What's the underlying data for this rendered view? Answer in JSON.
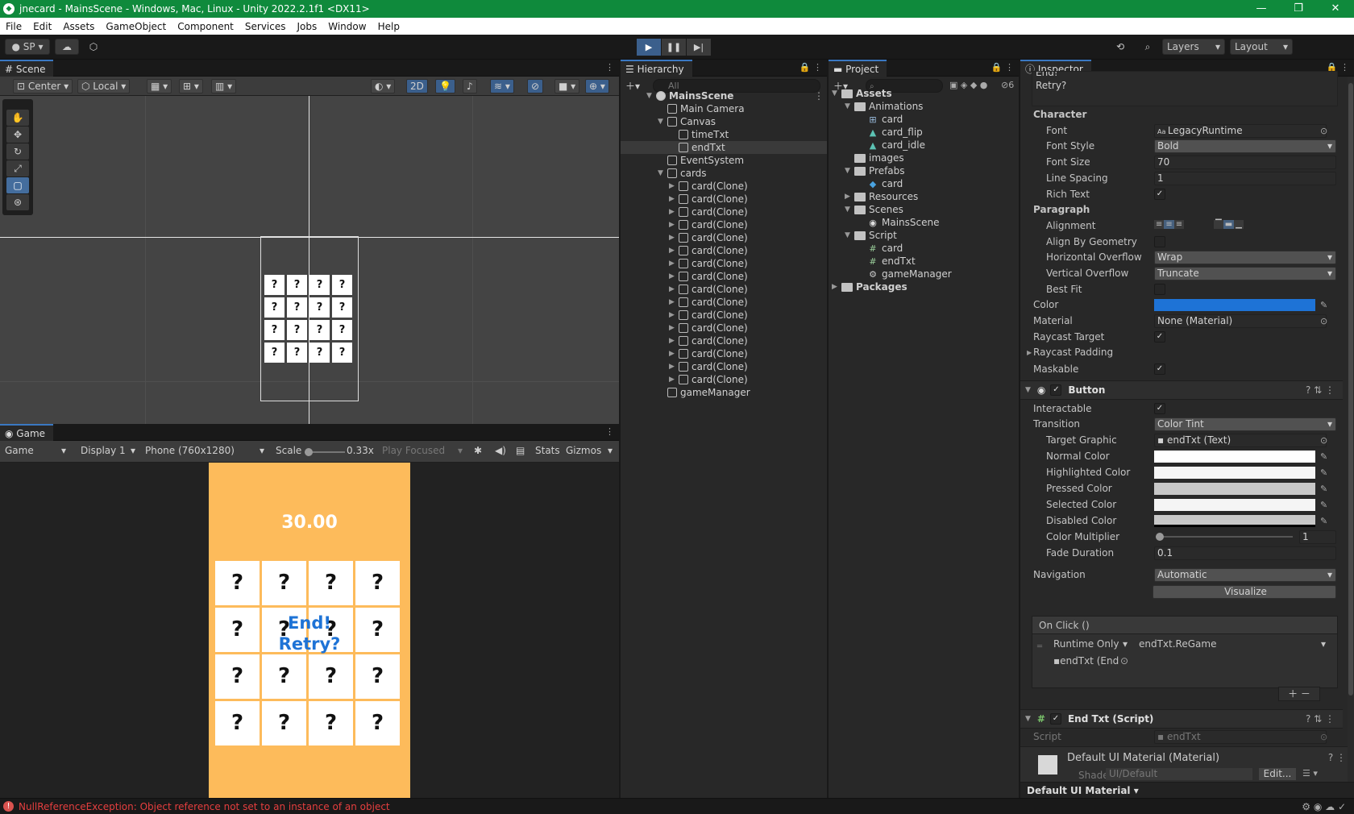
{
  "window": {
    "title": "jnecard - MainsScene - Windows, Mac, Linux - Unity 2022.2.1f1 <DX11>",
    "controls": [
      "—",
      "❐",
      "✕"
    ]
  },
  "menu": [
    "File",
    "Edit",
    "Assets",
    "GameObject",
    "Component",
    "Services",
    "Jobs",
    "Window",
    "Help"
  ],
  "toolbar": {
    "account": "SP",
    "layers": "Layers",
    "layout": "Layout"
  },
  "scene": {
    "tab": "Scene",
    "pivot": "Center",
    "space": "Local",
    "mode_2d": "2D",
    "cards": [
      "?",
      "?",
      "?",
      "?",
      "?",
      "?",
      "?",
      "?",
      "?",
      "?",
      "?",
      "?",
      "?",
      "?",
      "?",
      "?"
    ]
  },
  "game": {
    "tab": "Game",
    "view": "Game",
    "display": "Display 1",
    "resolution": "Phone (760x1280)",
    "scale_label": "Scale",
    "scale_value": "0.33x",
    "play_focused": "Play Focused",
    "stats": "Stats",
    "gizmos": "Gizmos",
    "timer": "30.00",
    "end_line1": "End!",
    "end_line2": "Retry?",
    "cards": [
      "?",
      "?",
      "?",
      "?",
      "?",
      "?",
      "?",
      "?",
      "?",
      "?",
      "?",
      "?",
      "?",
      "?",
      "?",
      "?"
    ]
  },
  "hierarchy": {
    "tab": "Hierarchy",
    "search_placeholder": "All",
    "items": [
      {
        "label": "MainsScene",
        "depth": 0
      },
      {
        "label": "Main Camera",
        "depth": 1
      },
      {
        "label": "Canvas",
        "depth": 1
      },
      {
        "label": "timeTxt",
        "depth": 2
      },
      {
        "label": "endTxt",
        "depth": 2
      },
      {
        "label": "EventSystem",
        "depth": 1
      },
      {
        "label": "cards",
        "depth": 1
      },
      {
        "label": "card(Clone)",
        "depth": 2
      },
      {
        "label": "card(Clone)",
        "depth": 2
      },
      {
        "label": "card(Clone)",
        "depth": 2
      },
      {
        "label": "card(Clone)",
        "depth": 2
      },
      {
        "label": "card(Clone)",
        "depth": 2
      },
      {
        "label": "card(Clone)",
        "depth": 2
      },
      {
        "label": "card(Clone)",
        "depth": 2
      },
      {
        "label": "card(Clone)",
        "depth": 2
      },
      {
        "label": "card(Clone)",
        "depth": 2
      },
      {
        "label": "card(Clone)",
        "depth": 2
      },
      {
        "label": "card(Clone)",
        "depth": 2
      },
      {
        "label": "card(Clone)",
        "depth": 2
      },
      {
        "label": "card(Clone)",
        "depth": 2
      },
      {
        "label": "card(Clone)",
        "depth": 2
      },
      {
        "label": "card(Clone)",
        "depth": 2
      },
      {
        "label": "card(Clone)",
        "depth": 2
      },
      {
        "label": "gameManager",
        "depth": 1
      }
    ]
  },
  "project": {
    "tab": "Project",
    "badge": "6",
    "items": [
      {
        "label": "Assets",
        "depth": 0,
        "kind": "folder"
      },
      {
        "label": "Animations",
        "depth": 1,
        "kind": "folder"
      },
      {
        "label": "card",
        "depth": 2,
        "kind": "anim"
      },
      {
        "label": "card_flip",
        "depth": 2,
        "kind": "clip"
      },
      {
        "label": "card_idle",
        "depth": 2,
        "kind": "clip"
      },
      {
        "label": "images",
        "depth": 1,
        "kind": "folder"
      },
      {
        "label": "Prefabs",
        "depth": 1,
        "kind": "folder"
      },
      {
        "label": "card",
        "depth": 2,
        "kind": "prefab"
      },
      {
        "label": "Resources",
        "depth": 1,
        "kind": "folder"
      },
      {
        "label": "Scenes",
        "depth": 1,
        "kind": "folder"
      },
      {
        "label": "MainsScene",
        "depth": 2,
        "kind": "scene"
      },
      {
        "label": "Script",
        "depth": 1,
        "kind": "folder"
      },
      {
        "label": "card",
        "depth": 2,
        "kind": "script"
      },
      {
        "label": "endTxt",
        "depth": 2,
        "kind": "script"
      },
      {
        "label": "gameManager",
        "depth": 2,
        "kind": "gear"
      },
      {
        "label": "Packages",
        "depth": 0,
        "kind": "folder"
      }
    ]
  },
  "inspector": {
    "tab": "Inspector",
    "text_preview": [
      "End!",
      "Retry?"
    ],
    "character_header": "Character",
    "font_label": "Font",
    "font_value": "LegacyRuntime",
    "font_style_label": "Font Style",
    "font_style_value": "Bold",
    "font_size_label": "Font Size",
    "font_size_value": "70",
    "line_spacing_label": "Line Spacing",
    "line_spacing_value": "1",
    "rich_text_label": "Rich Text",
    "paragraph_header": "Paragraph",
    "alignment_label": "Alignment",
    "align_geometry_label": "Align By Geometry",
    "h_overflow_label": "Horizontal Overflow",
    "h_overflow_value": "Wrap",
    "v_overflow_label": "Vertical Overflow",
    "v_overflow_value": "Truncate",
    "best_fit_label": "Best Fit",
    "color_label": "Color",
    "color_value": "#1e73d6",
    "material_label": "Material",
    "material_value": "None (Material)",
    "raycast_label": "Raycast Target",
    "raycast_padding_label": "Raycast Padding",
    "maskable_label": "Maskable",
    "button_header": "Button",
    "interactable_label": "Interactable",
    "transition_label": "Transition",
    "transition_value": "Color Tint",
    "target_graphic_label": "Target Graphic",
    "target_graphic_value": "endTxt (Text)",
    "normal_color_label": "Normal Color",
    "highlighted_color_label": "Highlighted Color",
    "pressed_color_label": "Pressed Color",
    "selected_color_label": "Selected Color",
    "disabled_color_label": "Disabled Color",
    "color_multiplier_label": "Color Multiplier",
    "color_multiplier_value": "1",
    "fade_duration_label": "Fade Duration",
    "fade_duration_value": "0.1",
    "navigation_label": "Navigation",
    "navigation_value": "Automatic",
    "visualize_label": "Visualize",
    "onclick_label": "On Click ()",
    "runtime_value": "Runtime Only",
    "function_value": "endTxt.ReGame",
    "object_value": "endTxt (End",
    "end_txt_header": "End Txt (Script)",
    "script_label": "Script",
    "script_value": "endTxt",
    "material_header": "Default UI Material (Material)",
    "shader_label": "Shader",
    "shader_value": "UI/Default",
    "edit_label": "Edit...",
    "footer_label": "Default UI Material"
  },
  "status": {
    "error": "NullReferenceException: Object reference not set to an instance of an object"
  }
}
